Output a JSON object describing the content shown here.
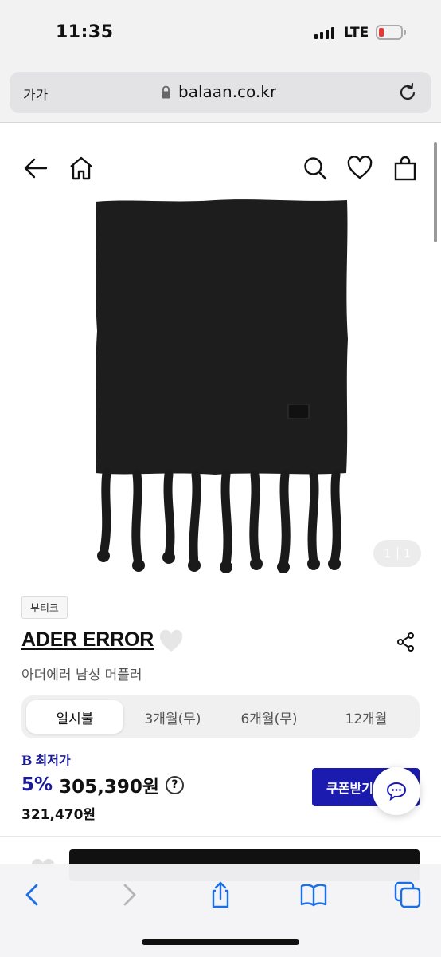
{
  "status_bar": {
    "time": "11:35",
    "network": "LTE"
  },
  "browser": {
    "text_size": "가가",
    "url": "balaan.co.kr"
  },
  "product": {
    "image_counter": {
      "current": "1",
      "total": "1"
    },
    "badge": "부티크",
    "brand": "ADER ERROR",
    "name": "아더에러 남성 머플러"
  },
  "payment_tabs": [
    "일시불",
    "3개월(무)",
    "6개월(무)",
    "12개월"
  ],
  "pricing": {
    "best_label_icon": "B",
    "best_label": "최저가",
    "discount": "5%",
    "sale_price": "305,390원",
    "help_icon": "?",
    "original_price": "321,470원",
    "coupon_button": "쿠폰받기"
  },
  "colors": {
    "accent": "#1b1bb0",
    "battery_low": "#e53935"
  },
  "icons": [
    "back-arrow-icon",
    "home-icon",
    "search-icon",
    "heart-icon",
    "shopping-bag-icon",
    "share-icon",
    "chat-icon",
    "lock-icon",
    "reload-icon",
    "safari-back-icon",
    "safari-forward-icon",
    "safari-share-icon",
    "bookmarks-icon",
    "tabs-icon"
  ]
}
